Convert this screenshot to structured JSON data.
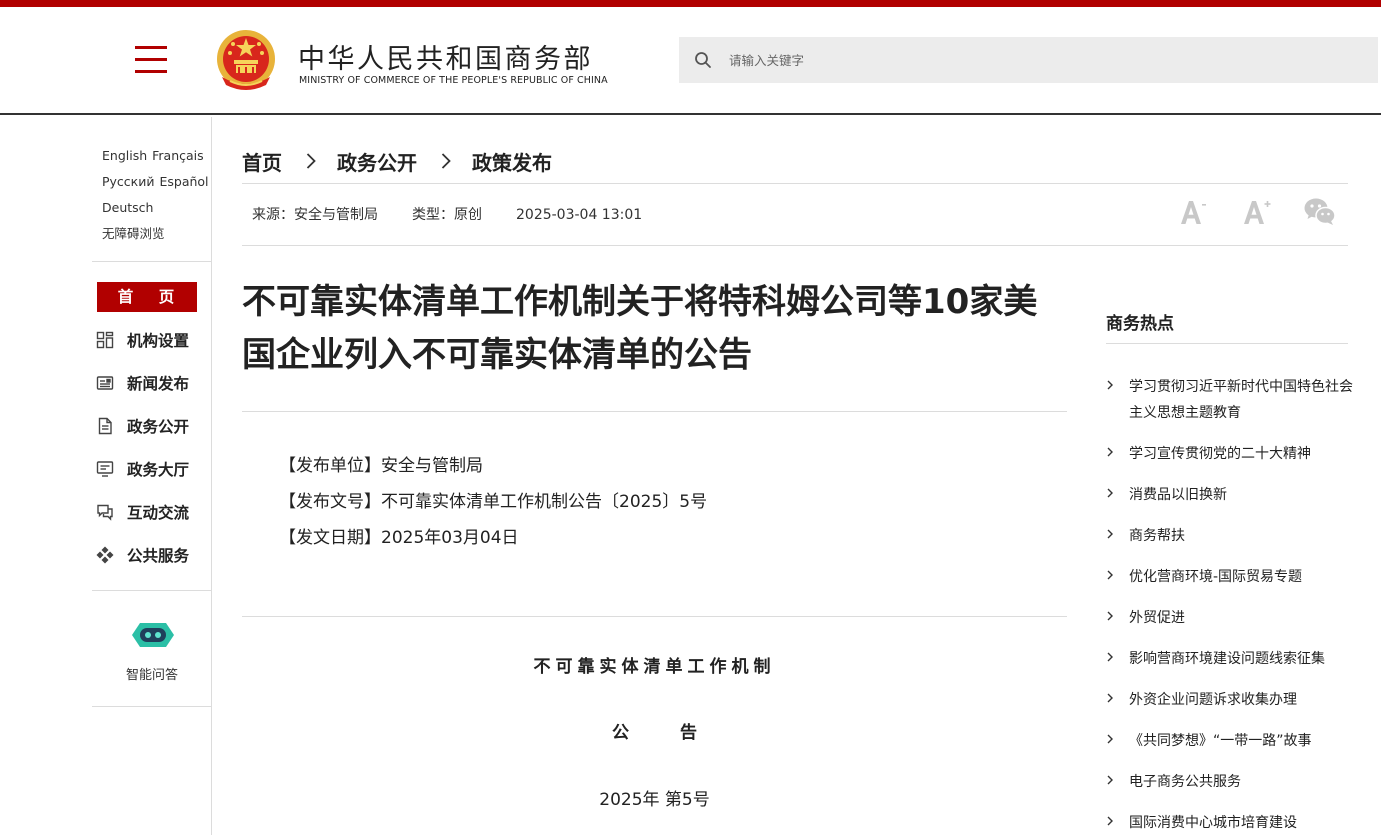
{
  "header": {
    "brand_cn": "中华人民共和国商务部",
    "brand_en": "MINISTRY OF COMMERCE OF THE PEOPLE'S REPUBLIC OF CHINA",
    "search_placeholder": "请输入关键字",
    "accent_color": "#b10000"
  },
  "sidebar": {
    "languages": [
      "English",
      "Français",
      "Русский",
      "Español",
      "Deutsch"
    ],
    "accessibility": "无障碍浏览",
    "home": "首 页",
    "items": [
      {
        "label": "机构设置",
        "icon": "grid-icon"
      },
      {
        "label": "新闻发布",
        "icon": "news-icon"
      },
      {
        "label": "政务公开",
        "icon": "document-icon"
      },
      {
        "label": "政务大厅",
        "icon": "monitor-icon"
      },
      {
        "label": "互动交流",
        "icon": "chat-icon"
      },
      {
        "label": "公共服务",
        "icon": "diamond-arrows-icon"
      }
    ],
    "assistant": "智能问答"
  },
  "breadcrumb": [
    "首页",
    "政务公开",
    "政策发布"
  ],
  "meta": {
    "source": "来源：安全与管制局",
    "type": "类型：原创",
    "datetime": "2025-03-04 13:01"
  },
  "tools": [
    "font-decrease-icon",
    "font-increase-icon",
    "wechat-icon"
  ],
  "article": {
    "title": "不可靠实体清单工作机制关于将特科姆公司等10家美国企业列入不可靠实体清单的公告",
    "info": [
      "【发布单位】安全与管制局",
      "【发布文号】不可靠实体清单工作机制公告〔2025〕5号",
      "【发文日期】2025年03月04日"
    ],
    "doc_org": "不可靠实体清单工作机制",
    "doc_announce": "公　　　告",
    "doc_number": "2025年 第5号"
  },
  "hot": {
    "title": "商务热点",
    "items": [
      "学习贯彻习近平新时代中国特色社会主义思想主题教育",
      "学习宣传贯彻党的二十大精神",
      "消费品以旧换新",
      "商务帮扶",
      "优化营商环境-国际贸易专题",
      "外贸促进",
      "影响营商环境建设问题线索征集",
      "外资企业问题诉求收集办理",
      "《共同梦想》“一带一路”故事",
      "电子商务公共服务",
      "国际消费中心城市培育建设"
    ]
  }
}
